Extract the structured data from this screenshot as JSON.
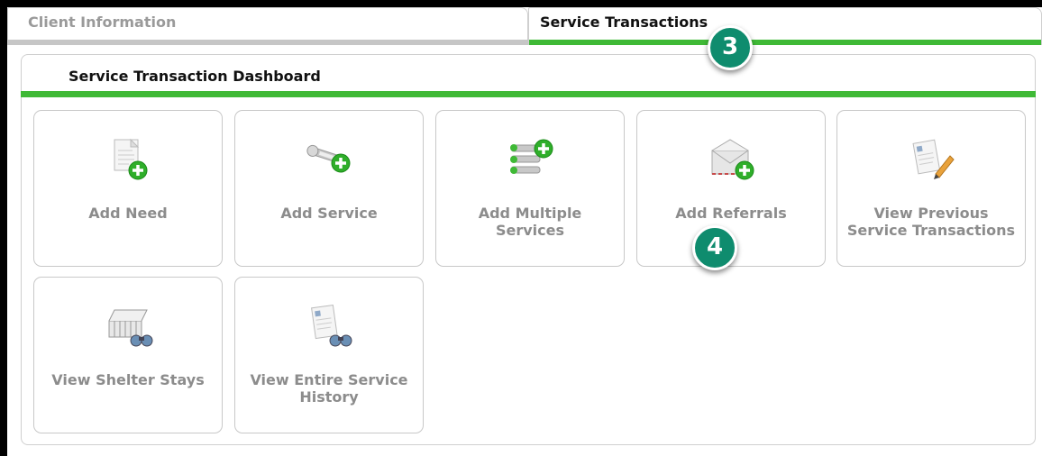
{
  "tabs": [
    {
      "label": "Client Information",
      "active": false
    },
    {
      "label": "Service Transactions",
      "active": true
    }
  ],
  "callouts": [
    "3",
    "4"
  ],
  "panel": {
    "title": "Service Transaction Dashboard"
  },
  "tiles": [
    {
      "label": "Add Need",
      "icon": "document-add-icon"
    },
    {
      "label": "Add Service",
      "icon": "key-add-icon"
    },
    {
      "label": "Add Multiple Services",
      "icon": "keys-add-icon"
    },
    {
      "label": "Add Referrals",
      "icon": "envelope-add-icon"
    },
    {
      "label": "View Previous Service Transactions",
      "icon": "document-edit-icon"
    },
    {
      "label": "View Shelter Stays",
      "icon": "shelter-binoculars-icon"
    },
    {
      "label": "View Entire Service History",
      "icon": "history-binoculars-icon"
    }
  ],
  "colors": {
    "accent": "#3fb936",
    "callout": "#0f8c6e",
    "tile_text": "#8c8c8c"
  }
}
